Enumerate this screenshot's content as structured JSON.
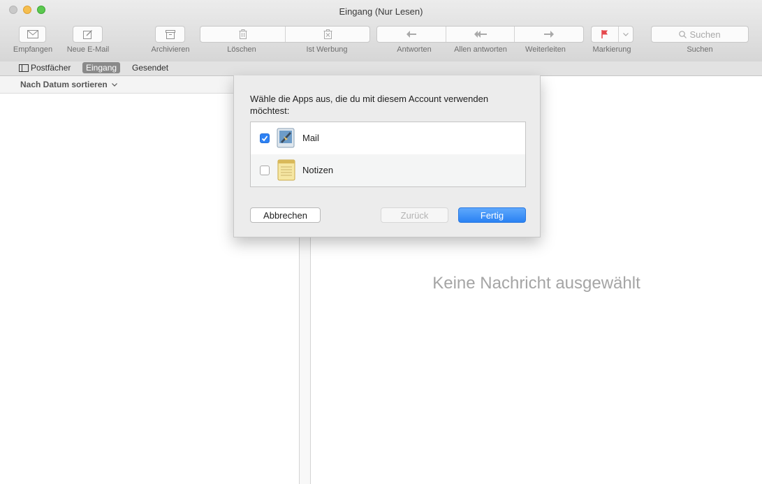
{
  "window": {
    "title": "Eingang (Nur Lesen)"
  },
  "toolbar": {
    "get_mail": "Empfangen",
    "new_mail": "Neue E-Mail",
    "archive": "Archivieren",
    "delete": "Löschen",
    "junk": "Ist Werbung",
    "reply": "Antworten",
    "reply_all": "Allen antworten",
    "forward": "Weiterleiten",
    "flag": "Markierung",
    "search_placeholder": "Suchen",
    "search_label": "Suchen"
  },
  "favorites": {
    "mailboxes": "Postfächer",
    "inbox": "Eingang",
    "sent": "Gesendet"
  },
  "message_list": {
    "sort_label": "Nach Datum sortieren"
  },
  "viewer": {
    "empty_message": "Keine Nachricht ausgewählt"
  },
  "sheet": {
    "prompt": "Wähle die Apps aus, die du mit diesem Account verwenden möchtest:",
    "apps": [
      {
        "name": "Mail",
        "checked": true,
        "icon": "mail-app-icon"
      },
      {
        "name": "Notizen",
        "checked": false,
        "icon": "notes-app-icon"
      }
    ],
    "cancel_label": "Abbrechen",
    "back_label": "Zurück",
    "done_label": "Fertig"
  },
  "colors": {
    "accent": "#2e82f4",
    "flag": "#e5484d"
  }
}
